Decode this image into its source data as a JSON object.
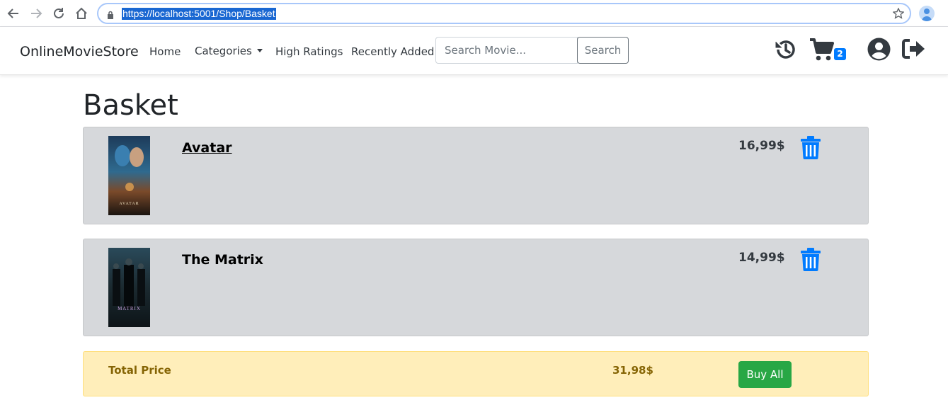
{
  "browser": {
    "url": "https://localhost:5001/Shop/Basket"
  },
  "navbar": {
    "brand": "OnlineMovieStore",
    "links": [
      "Home",
      "Categories",
      "High Ratings",
      "Recently Added"
    ],
    "search_placeholder": "Search Movie...",
    "search_button": "Search",
    "cart_count": "2"
  },
  "page": {
    "title": "Basket"
  },
  "basket": {
    "items": [
      {
        "title": "Avatar",
        "price": "16,99$",
        "poster_label": "AVATAR"
      },
      {
        "title": "The Matrix",
        "price": "14,99$",
        "poster_label": "MATRIX"
      }
    ]
  },
  "total": {
    "label": "Total Price",
    "value": "31,98$",
    "buy_button": "Buy All"
  },
  "colors": {
    "accent": "#007bff",
    "card_bg": "#d6d8db",
    "total_bg": "#ffeeba",
    "buy_green": "#28a745"
  }
}
